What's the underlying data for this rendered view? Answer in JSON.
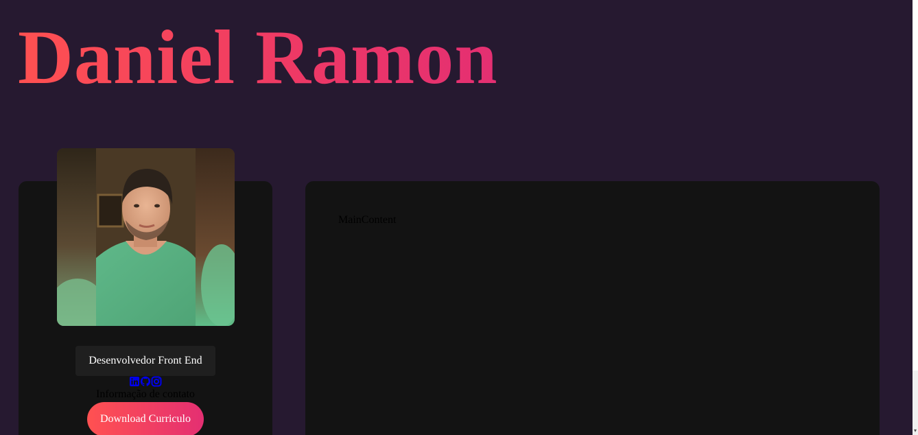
{
  "header": {
    "title": "Daniel Ramon"
  },
  "sidebar": {
    "photo_alt": "profile-photo",
    "role": "Desenvolvedor Front End",
    "social_icons": [
      "linkedin-icon",
      "github-icon",
      "instagram-icon"
    ],
    "contact_label": "Informação de contato",
    "download_label": "Download Curriculo"
  },
  "main": {
    "content_label": "MainContent"
  },
  "colors": {
    "background": "#261930",
    "panel": "#131313",
    "accent_start": "#ff5151",
    "accent_end": "#e42f72",
    "link": "#0000ee"
  }
}
